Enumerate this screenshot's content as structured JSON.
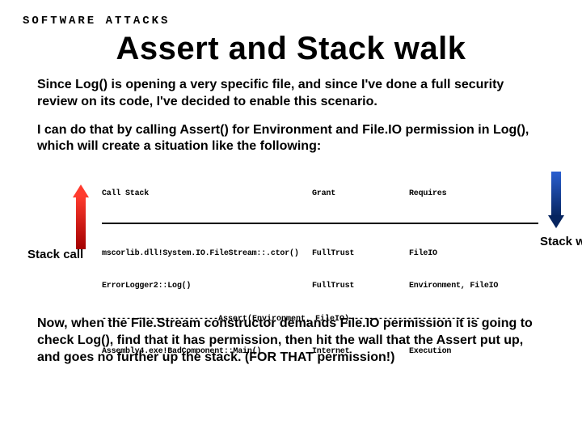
{
  "crumb": "SOFTWARE ATTACKS",
  "title": "Assert and Stack walk",
  "para1": "Since Log() is opening a very specific file, and since I've done a full security review on its code, I've decided to enable this scenario.",
  "para2": "I can do that by calling Assert() for Environment and File.IO permission in Log(), which will create a situation like the following:",
  "table": {
    "headers": {
      "call": "Call Stack",
      "grant": "Grant",
      "req": "Requires"
    },
    "rows": [
      {
        "call": "mscorlib.dll!System.IO.FileStream::.ctor()",
        "grant": "FullTrust",
        "req": "FileIO"
      },
      {
        "call": "ErrorLogger2::Log()",
        "grant": "FullTrust",
        "req": "Environment, FileIO"
      }
    ],
    "assert_line": "------------------------Assert(Environment, FileIO)---------------------------",
    "row_after": {
      "call": "Assembly4.exe!BadComponent::Main()",
      "grant": "Internet",
      "req": "Execution"
    }
  },
  "label_left": "Stack call",
  "label_right": "Stack walk",
  "para3": "Now, when the File.Stream constructor demands File.IO permission it is going to check Log(), find that it has permission, then hit the wall that the Assert put up, and goes no further up the stack. (FOR THAT permission!)"
}
